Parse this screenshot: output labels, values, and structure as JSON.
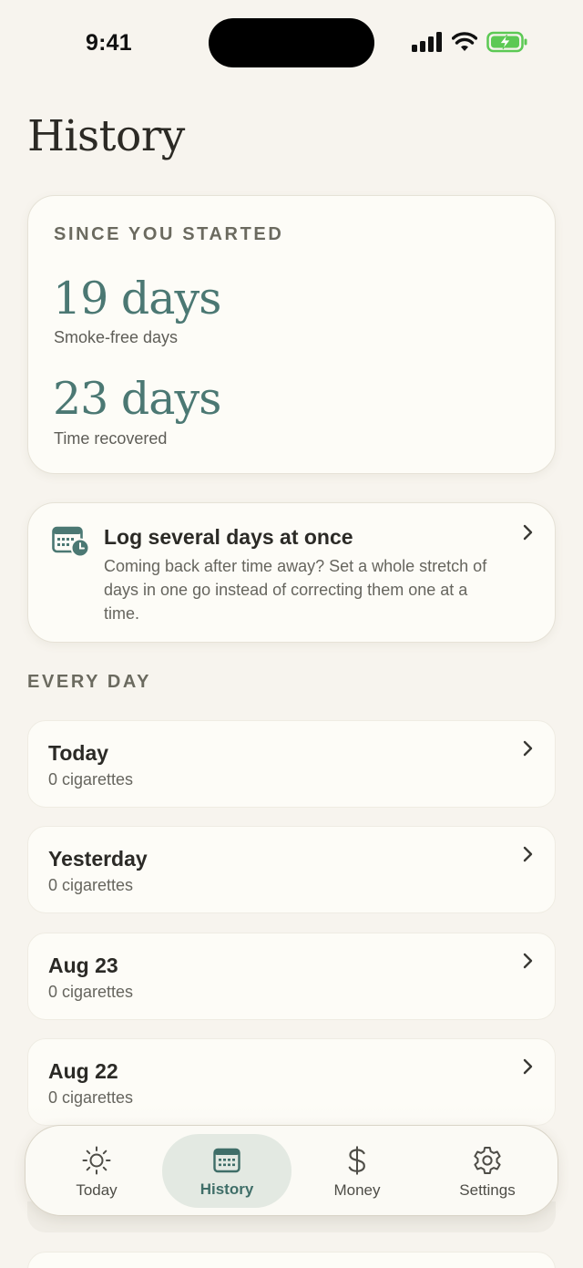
{
  "status_bar": {
    "time": "9:41"
  },
  "page": {
    "title": "History"
  },
  "stats": {
    "eyebrow": "SINCE YOU STARTED",
    "items": [
      {
        "value": "19 days",
        "label": "Smoke-free days"
      },
      {
        "value": "23 days",
        "label": "Time recovered"
      }
    ]
  },
  "log_card": {
    "title": "Log several days at once",
    "description": "Coming back after time away? Set a whole stretch of days in one go instead of correcting them one at a time."
  },
  "every_day": {
    "label": "EVERY DAY",
    "days": [
      {
        "title": "Today",
        "subtitle": "0 cigarettes"
      },
      {
        "title": "Yesterday",
        "subtitle": "0 cigarettes"
      },
      {
        "title": "Aug 23",
        "subtitle": "0 cigarettes"
      },
      {
        "title": "Aug 22",
        "subtitle": "0 cigarettes"
      }
    ]
  },
  "tabs": [
    {
      "label": "Today",
      "icon": "sun-icon",
      "active": false
    },
    {
      "label": "History",
      "icon": "calendar-icon",
      "active": true
    },
    {
      "label": "Money",
      "icon": "dollar-icon",
      "active": false
    },
    {
      "label": "Settings",
      "icon": "gear-icon",
      "active": false
    }
  ],
  "colors": {
    "accent": "#4b7873",
    "background": "#f7f4ee",
    "card": "#fdfcf7",
    "battery": "#5cc954"
  }
}
